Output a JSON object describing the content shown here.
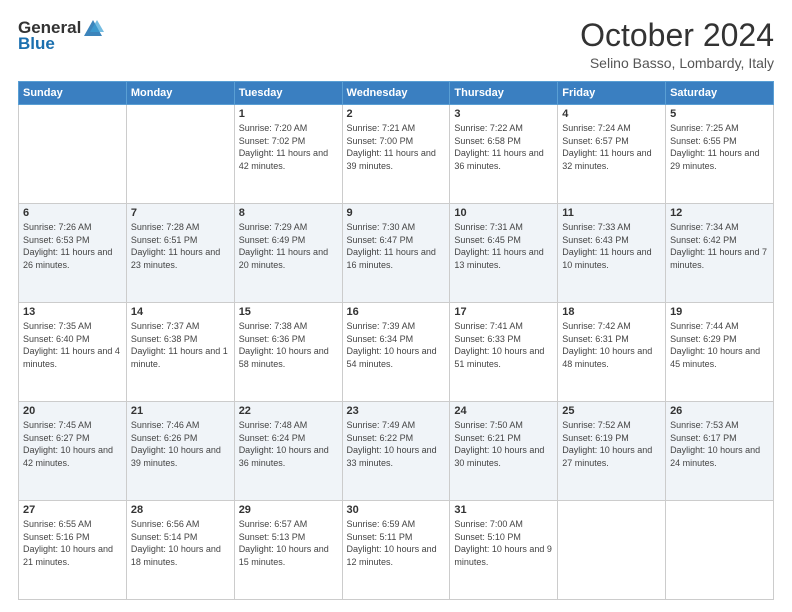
{
  "header": {
    "logo_general": "General",
    "logo_blue": "Blue",
    "month": "October 2024",
    "location": "Selino Basso, Lombardy, Italy"
  },
  "days_of_week": [
    "Sunday",
    "Monday",
    "Tuesday",
    "Wednesday",
    "Thursday",
    "Friday",
    "Saturday"
  ],
  "weeks": [
    [
      {
        "day": "",
        "sunrise": "",
        "sunset": "",
        "daylight": ""
      },
      {
        "day": "",
        "sunrise": "",
        "sunset": "",
        "daylight": ""
      },
      {
        "day": "1",
        "sunrise": "Sunrise: 7:20 AM",
        "sunset": "Sunset: 7:02 PM",
        "daylight": "Daylight: 11 hours and 42 minutes."
      },
      {
        "day": "2",
        "sunrise": "Sunrise: 7:21 AM",
        "sunset": "Sunset: 7:00 PM",
        "daylight": "Daylight: 11 hours and 39 minutes."
      },
      {
        "day": "3",
        "sunrise": "Sunrise: 7:22 AM",
        "sunset": "Sunset: 6:58 PM",
        "daylight": "Daylight: 11 hours and 36 minutes."
      },
      {
        "day": "4",
        "sunrise": "Sunrise: 7:24 AM",
        "sunset": "Sunset: 6:57 PM",
        "daylight": "Daylight: 11 hours and 32 minutes."
      },
      {
        "day": "5",
        "sunrise": "Sunrise: 7:25 AM",
        "sunset": "Sunset: 6:55 PM",
        "daylight": "Daylight: 11 hours and 29 minutes."
      }
    ],
    [
      {
        "day": "6",
        "sunrise": "Sunrise: 7:26 AM",
        "sunset": "Sunset: 6:53 PM",
        "daylight": "Daylight: 11 hours and 26 minutes."
      },
      {
        "day": "7",
        "sunrise": "Sunrise: 7:28 AM",
        "sunset": "Sunset: 6:51 PM",
        "daylight": "Daylight: 11 hours and 23 minutes."
      },
      {
        "day": "8",
        "sunrise": "Sunrise: 7:29 AM",
        "sunset": "Sunset: 6:49 PM",
        "daylight": "Daylight: 11 hours and 20 minutes."
      },
      {
        "day": "9",
        "sunrise": "Sunrise: 7:30 AM",
        "sunset": "Sunset: 6:47 PM",
        "daylight": "Daylight: 11 hours and 16 minutes."
      },
      {
        "day": "10",
        "sunrise": "Sunrise: 7:31 AM",
        "sunset": "Sunset: 6:45 PM",
        "daylight": "Daylight: 11 hours and 13 minutes."
      },
      {
        "day": "11",
        "sunrise": "Sunrise: 7:33 AM",
        "sunset": "Sunset: 6:43 PM",
        "daylight": "Daylight: 11 hours and 10 minutes."
      },
      {
        "day": "12",
        "sunrise": "Sunrise: 7:34 AM",
        "sunset": "Sunset: 6:42 PM",
        "daylight": "Daylight: 11 hours and 7 minutes."
      }
    ],
    [
      {
        "day": "13",
        "sunrise": "Sunrise: 7:35 AM",
        "sunset": "Sunset: 6:40 PM",
        "daylight": "Daylight: 11 hours and 4 minutes."
      },
      {
        "day": "14",
        "sunrise": "Sunrise: 7:37 AM",
        "sunset": "Sunset: 6:38 PM",
        "daylight": "Daylight: 11 hours and 1 minute."
      },
      {
        "day": "15",
        "sunrise": "Sunrise: 7:38 AM",
        "sunset": "Sunset: 6:36 PM",
        "daylight": "Daylight: 10 hours and 58 minutes."
      },
      {
        "day": "16",
        "sunrise": "Sunrise: 7:39 AM",
        "sunset": "Sunset: 6:34 PM",
        "daylight": "Daylight: 10 hours and 54 minutes."
      },
      {
        "day": "17",
        "sunrise": "Sunrise: 7:41 AM",
        "sunset": "Sunset: 6:33 PM",
        "daylight": "Daylight: 10 hours and 51 minutes."
      },
      {
        "day": "18",
        "sunrise": "Sunrise: 7:42 AM",
        "sunset": "Sunset: 6:31 PM",
        "daylight": "Daylight: 10 hours and 48 minutes."
      },
      {
        "day": "19",
        "sunrise": "Sunrise: 7:44 AM",
        "sunset": "Sunset: 6:29 PM",
        "daylight": "Daylight: 10 hours and 45 minutes."
      }
    ],
    [
      {
        "day": "20",
        "sunrise": "Sunrise: 7:45 AM",
        "sunset": "Sunset: 6:27 PM",
        "daylight": "Daylight: 10 hours and 42 minutes."
      },
      {
        "day": "21",
        "sunrise": "Sunrise: 7:46 AM",
        "sunset": "Sunset: 6:26 PM",
        "daylight": "Daylight: 10 hours and 39 minutes."
      },
      {
        "day": "22",
        "sunrise": "Sunrise: 7:48 AM",
        "sunset": "Sunset: 6:24 PM",
        "daylight": "Daylight: 10 hours and 36 minutes."
      },
      {
        "day": "23",
        "sunrise": "Sunrise: 7:49 AM",
        "sunset": "Sunset: 6:22 PM",
        "daylight": "Daylight: 10 hours and 33 minutes."
      },
      {
        "day": "24",
        "sunrise": "Sunrise: 7:50 AM",
        "sunset": "Sunset: 6:21 PM",
        "daylight": "Daylight: 10 hours and 30 minutes."
      },
      {
        "day": "25",
        "sunrise": "Sunrise: 7:52 AM",
        "sunset": "Sunset: 6:19 PM",
        "daylight": "Daylight: 10 hours and 27 minutes."
      },
      {
        "day": "26",
        "sunrise": "Sunrise: 7:53 AM",
        "sunset": "Sunset: 6:17 PM",
        "daylight": "Daylight: 10 hours and 24 minutes."
      }
    ],
    [
      {
        "day": "27",
        "sunrise": "Sunrise: 6:55 AM",
        "sunset": "Sunset: 5:16 PM",
        "daylight": "Daylight: 10 hours and 21 minutes."
      },
      {
        "day": "28",
        "sunrise": "Sunrise: 6:56 AM",
        "sunset": "Sunset: 5:14 PM",
        "daylight": "Daylight: 10 hours and 18 minutes."
      },
      {
        "day": "29",
        "sunrise": "Sunrise: 6:57 AM",
        "sunset": "Sunset: 5:13 PM",
        "daylight": "Daylight: 10 hours and 15 minutes."
      },
      {
        "day": "30",
        "sunrise": "Sunrise: 6:59 AM",
        "sunset": "Sunset: 5:11 PM",
        "daylight": "Daylight: 10 hours and 12 minutes."
      },
      {
        "day": "31",
        "sunrise": "Sunrise: 7:00 AM",
        "sunset": "Sunset: 5:10 PM",
        "daylight": "Daylight: 10 hours and 9 minutes."
      },
      {
        "day": "",
        "sunrise": "",
        "sunset": "",
        "daylight": ""
      },
      {
        "day": "",
        "sunrise": "",
        "sunset": "",
        "daylight": ""
      }
    ]
  ]
}
